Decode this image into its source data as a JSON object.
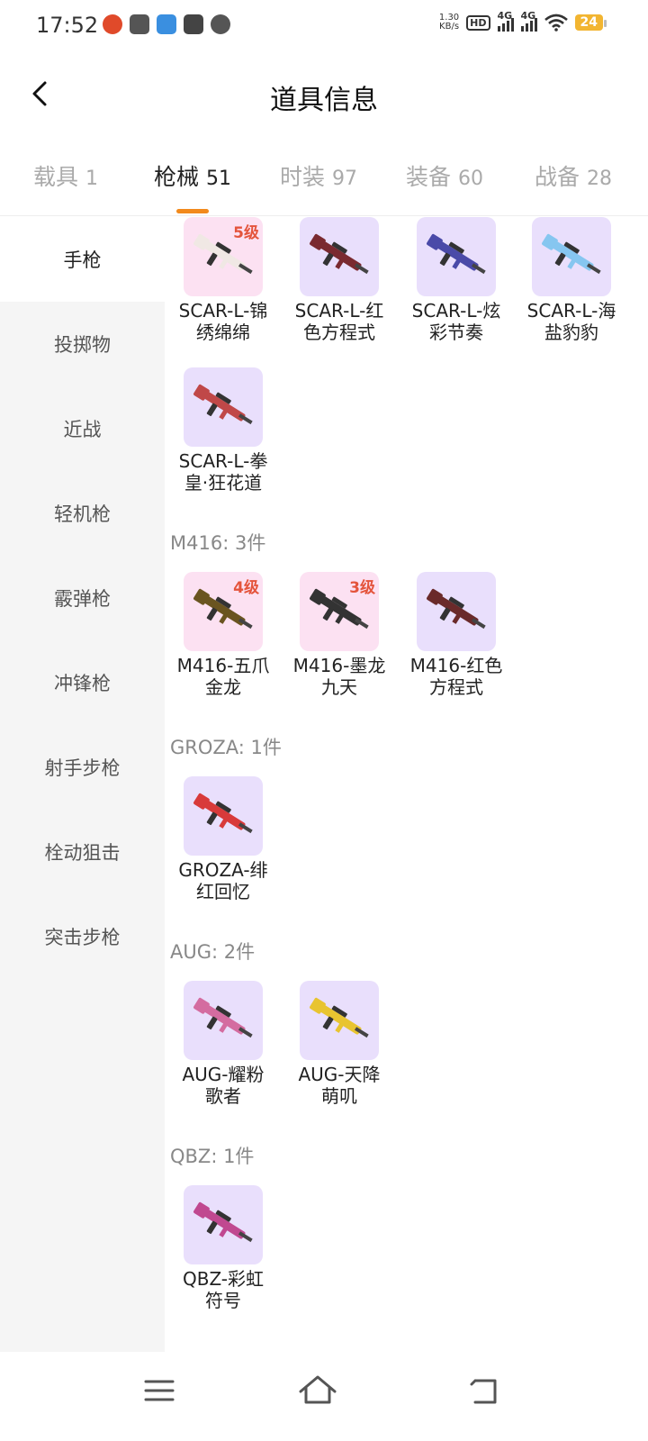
{
  "status_bar": {
    "time": "17:52",
    "net_speed_value": "1.30",
    "net_speed_unit": "KB/s",
    "hd": "HD",
    "sig1": "4G",
    "sig2": "4G",
    "battery": "24"
  },
  "header": {
    "title": "道具信息"
  },
  "tabs": [
    {
      "label": "载具",
      "count": "1"
    },
    {
      "label": "枪械",
      "count": "51"
    },
    {
      "label": "时装",
      "count": "97"
    },
    {
      "label": "装备",
      "count": "60"
    },
    {
      "label": "战备",
      "count": "28"
    }
  ],
  "sidebar": [
    {
      "label": "手枪"
    },
    {
      "label": "投掷物"
    },
    {
      "label": "近战"
    },
    {
      "label": "轻机枪"
    },
    {
      "label": "霰弹枪"
    },
    {
      "label": "冲锋枪"
    },
    {
      "label": "射手步枪"
    },
    {
      "label": "栓动狙击"
    },
    {
      "label": "突击步枪"
    }
  ],
  "groups": [
    {
      "label": "M416: 3件"
    },
    {
      "label": "GROZA: 1件"
    },
    {
      "label": "AUG: 2件"
    },
    {
      "label": "QBZ: 1件"
    }
  ],
  "items": [
    {
      "line1": "SCAR-L-锦",
      "line2": "绣绵绵",
      "level": "5级",
      "color": "#f0e8e4"
    },
    {
      "line1": "SCAR-L-红",
      "line2": "色方程式",
      "level": "",
      "color": "#7a2a30"
    },
    {
      "line1": "SCAR-L-炫",
      "line2": "彩节奏",
      "level": "",
      "color": "#4a4aa8"
    },
    {
      "line1": "SCAR-L-海",
      "line2": "盐豹豹",
      "level": "",
      "color": "#86c6f0"
    },
    {
      "line1": "SCAR-L-拳",
      "line2": "皇·狂花道",
      "level": "",
      "color": "#c04848"
    },
    {
      "line1": "M416-五爪",
      "line2": "金龙",
      "level": "4级",
      "color": "#6a5420"
    },
    {
      "line1": "M416-墨龙",
      "line2": "九天",
      "level": "3级",
      "color": "#333333"
    },
    {
      "line1": "M416-红色",
      "line2": "方程式",
      "level": "",
      "color": "#6a2a2a"
    },
    {
      "line1": "GROZA-绯",
      "line2": "红回忆",
      "level": "",
      "color": "#d83a3a"
    },
    {
      "line1": "AUG-耀粉",
      "line2": "歌者",
      "level": "",
      "color": "#d46ca0"
    },
    {
      "line1": "AUG-天降",
      "line2": "萌叽",
      "level": "",
      "color": "#e8c430"
    },
    {
      "line1": "QBZ-彩虹",
      "line2": "符号",
      "level": "",
      "color": "#c04890"
    }
  ],
  "colors": {
    "accent": "#f28a1c",
    "level_text": "#e4543c",
    "thumb_purple": "#e9dffc",
    "thumb_pink": "#fce1f2",
    "sidebar_bg": "#f5f5f5"
  }
}
